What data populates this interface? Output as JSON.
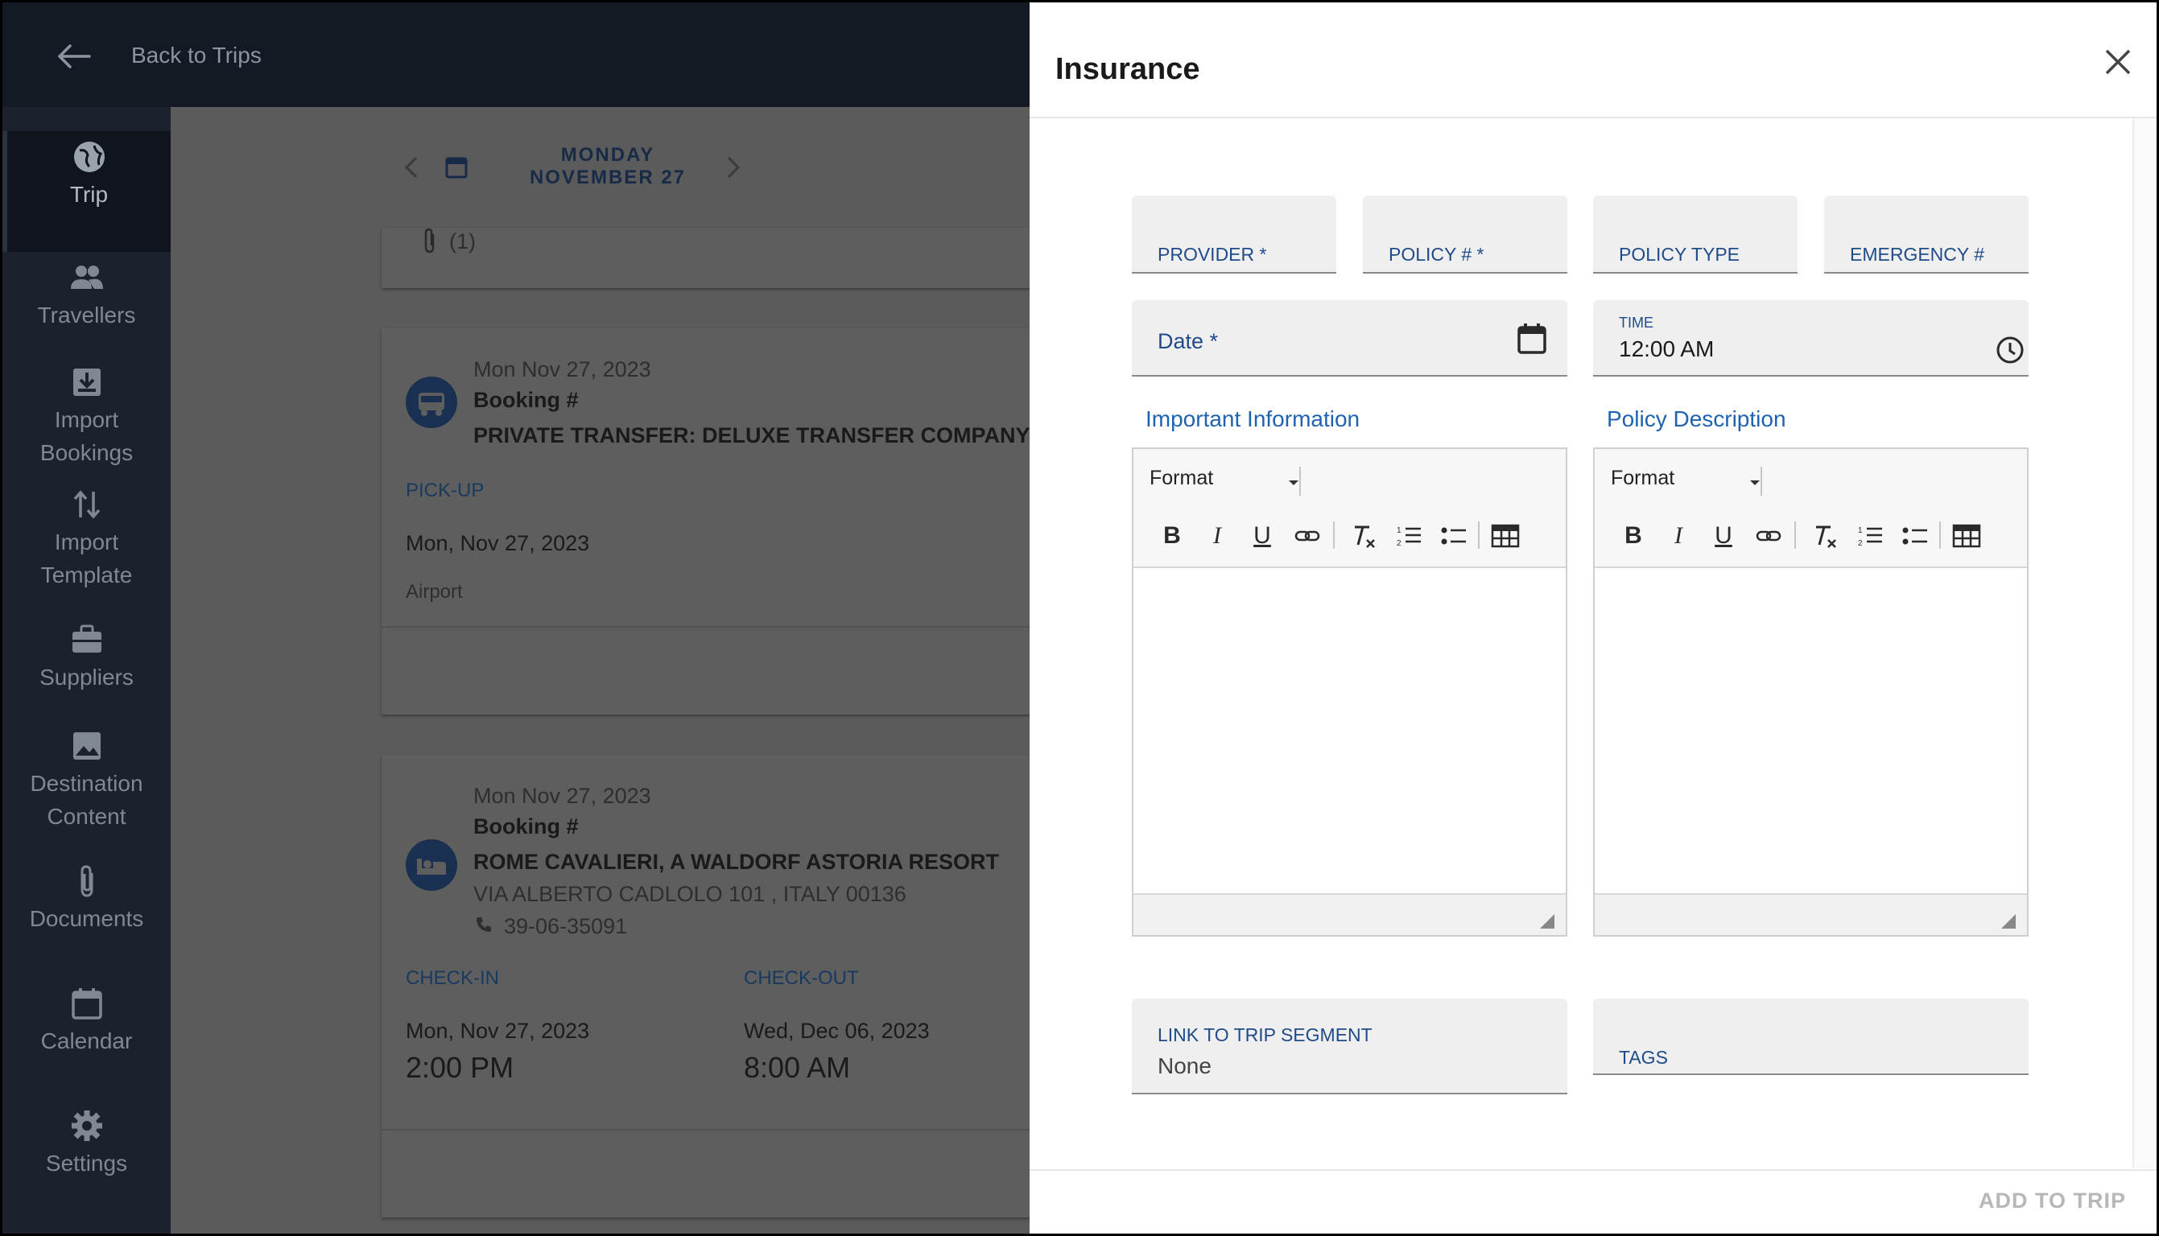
{
  "topbar": {
    "back_label": "Back to Trips"
  },
  "sidebar": {
    "items": [
      {
        "label": "Trip",
        "icon": "globe-icon"
      },
      {
        "label": "Travellers",
        "icon": "people-icon"
      },
      {
        "label": "Import\nBookings",
        "line1": "Import",
        "line2": "Bookings",
        "icon": "import-icon"
      },
      {
        "label": "Import\nTemplate",
        "line1": "Import",
        "line2": "Template",
        "icon": "swap-vertical-icon"
      },
      {
        "label": "Suppliers",
        "icon": "briefcase-icon"
      },
      {
        "label": "Destination\nContent",
        "line1": "Destination",
        "line2": "Content",
        "icon": "image-icon"
      },
      {
        "label": "Documents",
        "icon": "paperclip-icon"
      },
      {
        "label": "Calendar",
        "icon": "calendar-icon"
      },
      {
        "label": "Settings",
        "icon": "gear-icon"
      }
    ]
  },
  "date_nav": {
    "day": "MONDAY",
    "date": "NOVEMBER 27"
  },
  "cards": {
    "attachment_count": "(1)",
    "transfer": {
      "date": "Mon Nov 27, 2023",
      "booking": "Booking #",
      "title": "PRIVATE TRANSFER: DELUXE TRANSFER COMPANY",
      "pickup_label": "PICK-UP",
      "pickup_date": "Mon, Nov 27, 2023",
      "pickup_place": "Airport"
    },
    "hotel": {
      "date": "Mon Nov 27, 2023",
      "booking": "Booking #",
      "title": "ROME CAVALIERI, A WALDORF ASTORIA RESORT",
      "address": "VIA ALBERTO CADLOLO 101 , ITALY 00136",
      "phone": "39-06-35091",
      "checkin_label": "CHECK-IN",
      "checkin_date": "Mon, Nov 27, 2023",
      "checkin_time": "2:00 PM",
      "checkout_label": "CHECK-OUT",
      "checkout_date": "Wed, Dec 06, 2023",
      "checkout_time": "8:00 AM"
    }
  },
  "drawer": {
    "title": "Insurance",
    "fields": {
      "provider": "PROVIDER *",
      "policy_number": "POLICY # *",
      "policy_type": "POLICY TYPE",
      "emergency": "EMERGENCY #",
      "date": "Date *",
      "time_label": "TIME",
      "time_value": "12:00  AM",
      "link_label": "LINK TO TRIP SEGMENT",
      "link_value": "None",
      "tags": "TAGS"
    },
    "editors": {
      "important_label": "Important Information",
      "policy_label": "Policy Description",
      "format_label": "Format"
    },
    "add_button": "ADD TO TRIP"
  },
  "colors": {
    "accent": "#1f63b0",
    "sidebar": "#1b222d",
    "topbar": "#141a24",
    "overlay_card": "#1a3050"
  }
}
